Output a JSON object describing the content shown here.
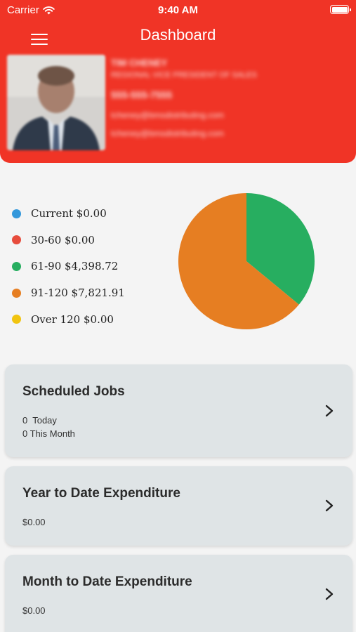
{
  "status_bar": {
    "carrier": "Carrier",
    "time": "9:40 AM"
  },
  "header": {
    "title": "Dashboard",
    "background": "#f03426"
  },
  "profile": {
    "name": "TIM CHENEY",
    "role": "REGIONAL VICE PRESIDENT OF SALES",
    "phone": "555-555-7555",
    "email_1": "tcheney@bmsdistributing.com",
    "email_2": "tcheney@bmsdistributing.com"
  },
  "chart_data": {
    "type": "pie",
    "series": [
      {
        "label": "Current $0.00",
        "value": 0,
        "color": "#3498db"
      },
      {
        "label": "30-60 $0.00",
        "value": 0,
        "color": "#e74c3c"
      },
      {
        "label": "61-90 $4,398.72",
        "value": 4398.72,
        "color": "#27ae60"
      },
      {
        "label": "91-120 $7,821.91",
        "value": 7821.91,
        "color": "#e67e22"
      },
      {
        "label": "Over 120 $0.00",
        "value": 0,
        "color": "#f1c40f"
      }
    ]
  },
  "cards": {
    "scheduled": {
      "title": "Scheduled Jobs",
      "today": "0  Today",
      "month": "0 This Month"
    },
    "ytd": {
      "title": "Year to Date Expenditure",
      "value": "$0.00"
    },
    "mtd": {
      "title": "Month to Date Expenditure",
      "value": "$0.00"
    }
  }
}
